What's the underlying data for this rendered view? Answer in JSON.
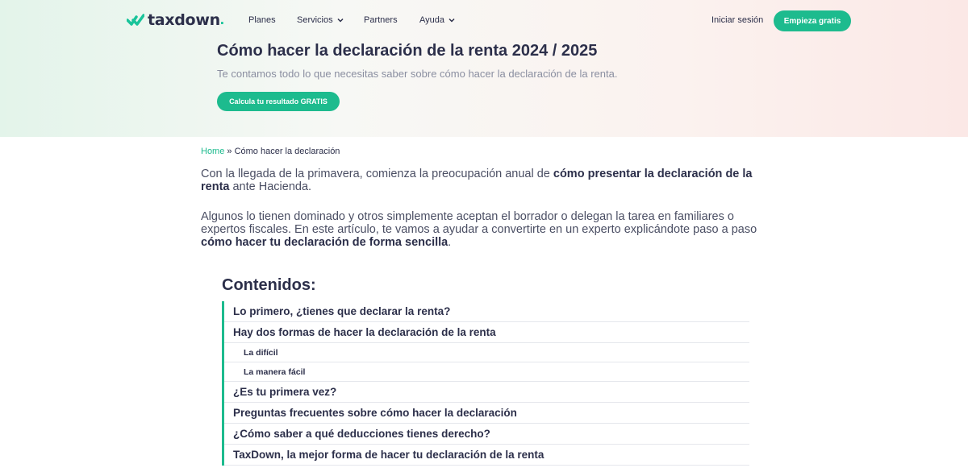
{
  "nav": {
    "logo_text": "taxdown",
    "logo_dot": ".",
    "items": [
      {
        "label": "Planes"
      },
      {
        "label": "Servicios"
      },
      {
        "label": "Partners"
      },
      {
        "label": "Ayuda"
      }
    ],
    "login_label": "Iniciar sesión",
    "cta_label": "Empieza gratis"
  },
  "hero": {
    "title": "Cómo hacer la declaración de la renta 2024 / 2025",
    "subtitle": "Te contamos todo lo que necesitas saber sobre cómo hacer la declaración de la renta.",
    "cta_label": "Calcula tu resultado GRATIS"
  },
  "breadcrumb": {
    "home": "Home",
    "separator": " » ",
    "current": "Cómo hacer la declaración"
  },
  "article": {
    "p1_a": "Con la llegada de la primavera, comienza la preocupación anual de ",
    "p1_b": "cómo presentar la declaración de la renta",
    "p1_c": " ante Hacienda.",
    "p2_a": "Algunos lo tienen dominado y otros simplemente aceptan el borrador o delegan la tarea en familiares o expertos fiscales. En este artículo, te vamos a ayudar a convertirte en un experto explicándote paso a paso ",
    "p2_b": "cómo hacer tu declaración de forma sencilla",
    "p2_c": "."
  },
  "toc": {
    "title": "Contenidos:",
    "items": [
      {
        "label": "Lo primero, ¿tienes que declarar la renta?"
      },
      {
        "label": "Hay dos formas de hacer la declaración de la renta"
      },
      {
        "label": "La difícil"
      },
      {
        "label": "La manera fácil"
      },
      {
        "label": "¿Es tu primera vez?"
      },
      {
        "label": "Preguntas frecuentes sobre cómo hacer la declaración"
      },
      {
        "label": "¿Cómo saber a qué deducciones tienes derecho?"
      },
      {
        "label": "TaxDown, la mejor forma de hacer tu declaración de la renta"
      }
    ]
  },
  "colors": {
    "accent": "#1dbb8e",
    "text": "#2c2f4a"
  }
}
